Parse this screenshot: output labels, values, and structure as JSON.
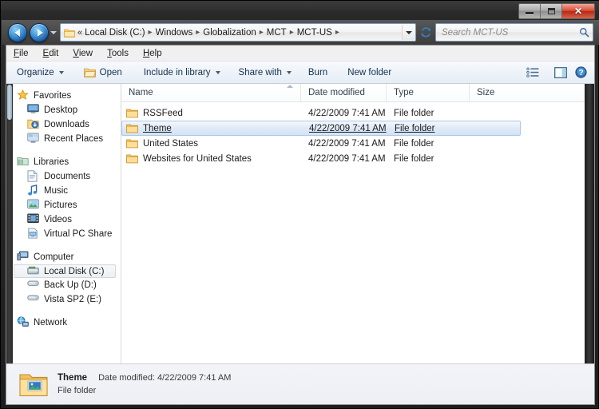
{
  "window": {
    "controls": {
      "minimize_label": "Minimize",
      "maximize_label": "Maximize",
      "close_label": "✕"
    }
  },
  "addressbar": {
    "back_label": "Back",
    "forward_label": "Forward",
    "history_dropdown_label": "Recent pages",
    "overflow": "«",
    "separator": "▸",
    "crumbs": [
      "Local Disk (C:)",
      "Windows",
      "Globalization",
      "MCT",
      "MCT-US"
    ],
    "dropdown_label": "Previous locations",
    "refresh_label": "Refresh",
    "search": {
      "placeholder": "Search MCT-US",
      "value": ""
    }
  },
  "menubar": {
    "items": [
      {
        "label": "File",
        "accel": "F"
      },
      {
        "label": "Edit",
        "accel": "E"
      },
      {
        "label": "View",
        "accel": "V"
      },
      {
        "label": "Tools",
        "accel": "T"
      },
      {
        "label": "Help",
        "accel": "H"
      }
    ]
  },
  "toolbar": {
    "organize_label": "Organize",
    "open_label": "Open",
    "include_label": "Include in library",
    "share_label": "Share with",
    "burn_label": "Burn",
    "new_folder_label": "New folder",
    "views_label": "Change your view",
    "preview_pane_label": "Show the preview pane",
    "help_label": "Get help"
  },
  "navpane": {
    "groups": [
      {
        "header": {
          "label": "Favorites",
          "icon": "star-icon"
        },
        "items": [
          {
            "label": "Desktop",
            "icon": "desktop-icon"
          },
          {
            "label": "Downloads",
            "icon": "downloads-icon"
          },
          {
            "label": "Recent Places",
            "icon": "recent-places-icon"
          }
        ]
      },
      {
        "header": {
          "label": "Libraries",
          "icon": "libraries-icon"
        },
        "items": [
          {
            "label": "Documents",
            "icon": "documents-icon"
          },
          {
            "label": "Music",
            "icon": "music-icon"
          },
          {
            "label": "Pictures",
            "icon": "pictures-icon"
          },
          {
            "label": "Videos",
            "icon": "videos-icon"
          },
          {
            "label": "Virtual PC Share",
            "icon": "share-icon"
          }
        ]
      },
      {
        "header": {
          "label": "Computer",
          "icon": "computer-icon"
        },
        "items": [
          {
            "label": "Local Disk (C:)",
            "icon": "harddisk-icon",
            "selected": true
          },
          {
            "label": "Back Up (D:)",
            "icon": "drive-icon"
          },
          {
            "label": "Vista SP2 (E:)",
            "icon": "drive-icon"
          }
        ]
      },
      {
        "header": {
          "label": "Network",
          "icon": "network-icon"
        },
        "items": []
      }
    ]
  },
  "filelist": {
    "columns": [
      {
        "label": "Name",
        "sorted": "asc"
      },
      {
        "label": "Date modified",
        "sorted": ""
      },
      {
        "label": "Type",
        "sorted": ""
      },
      {
        "label": "Size",
        "sorted": ""
      }
    ],
    "rows": [
      {
        "name": "RSSFeed",
        "date": "4/22/2009 7:41 AM",
        "type": "File folder",
        "size": "",
        "selected": false
      },
      {
        "name": "Theme",
        "date": "4/22/2009 7:41 AM",
        "type": "File folder",
        "size": "",
        "selected": true
      },
      {
        "name": "United States",
        "date": "4/22/2009 7:41 AM",
        "type": "File folder",
        "size": "",
        "selected": false
      },
      {
        "name": "Websites for United States",
        "date": "4/22/2009 7:41 AM",
        "type": "File folder",
        "size": "",
        "selected": false
      }
    ]
  },
  "details": {
    "title": "Theme",
    "date_label": "Date modified: 4/22/2009 7:41 AM",
    "kind": "File folder",
    "icon": "folder-theme-icon"
  },
  "colors": {
    "titlebar": "#2e2e2e",
    "close_button": "#c0392b",
    "selection": "#d3e3f5",
    "selection_border": "#a9c8e8",
    "folder_yellow": "#ffd27f",
    "accent_blue": "#3d94d6"
  }
}
